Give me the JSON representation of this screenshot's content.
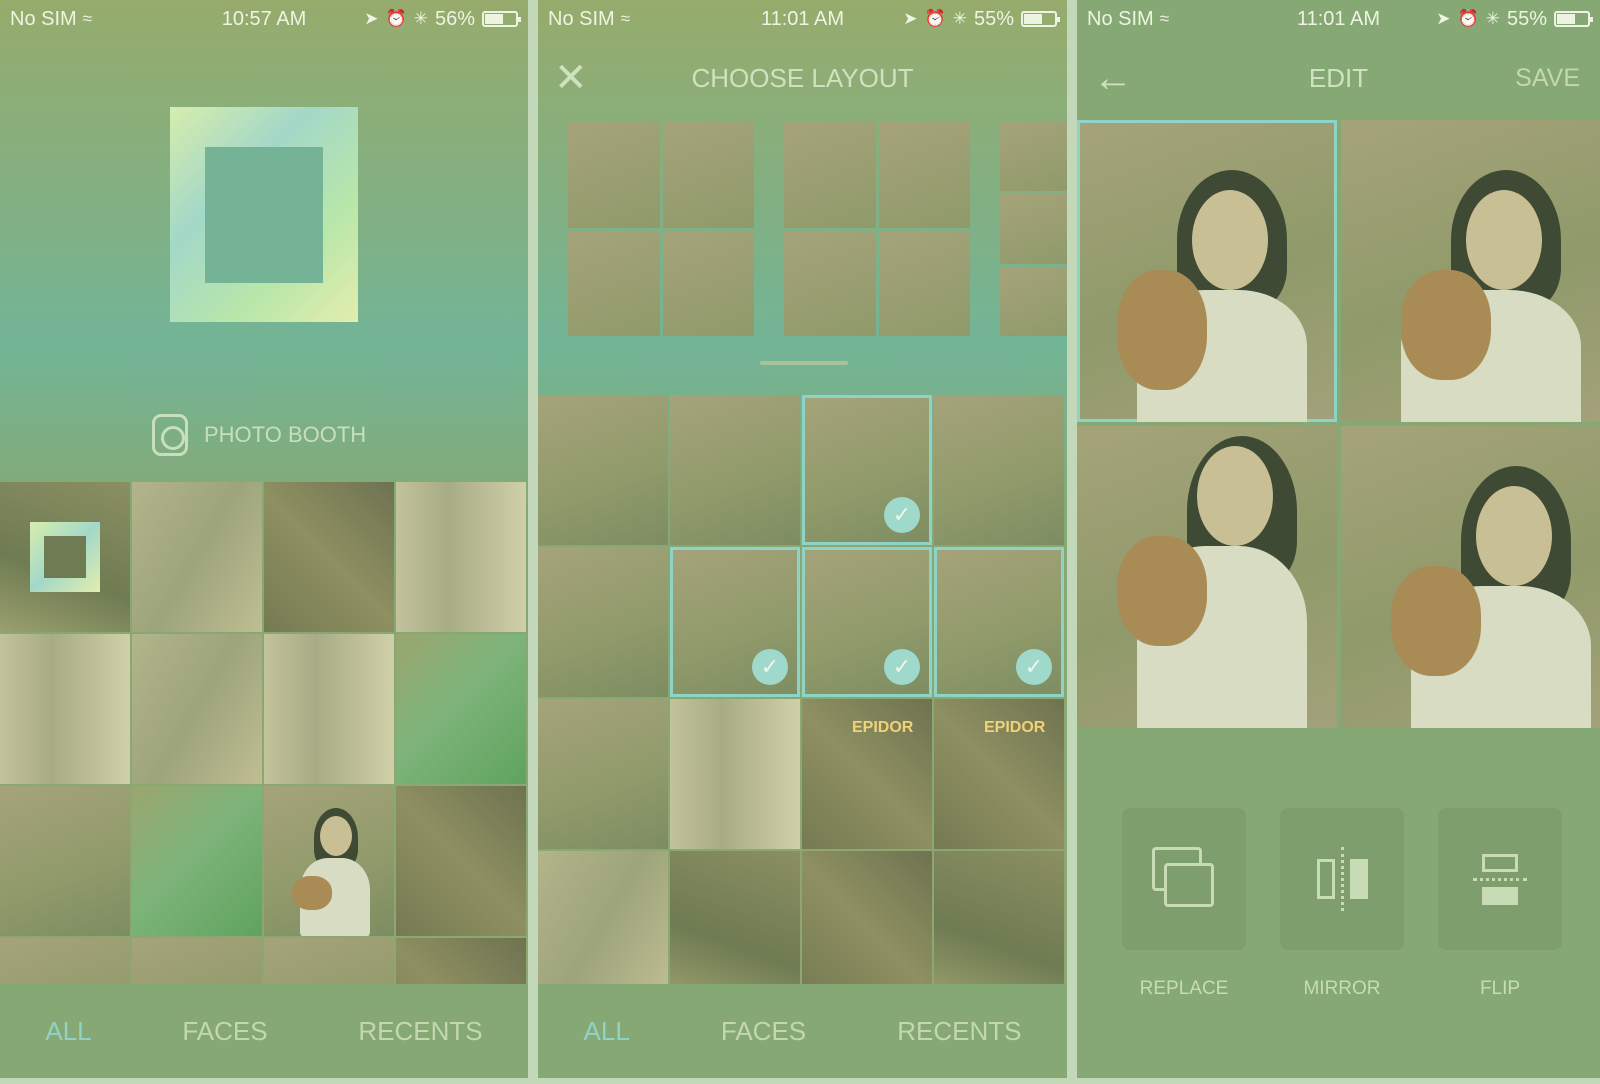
{
  "screens": [
    {
      "status": {
        "carrier": "No SIM",
        "time": "10:57 AM",
        "battery_pct": "56%",
        "battery_level": 0.56
      },
      "photo_booth_label": "PHOTO BOOTH",
      "tabs": [
        {
          "label": "ALL",
          "active": true
        },
        {
          "label": "FACES"
        },
        {
          "label": "RECENTS"
        }
      ]
    },
    {
      "status": {
        "carrier": "No SIM",
        "time": "11:01 AM",
        "battery_pct": "55%",
        "battery_level": 0.55
      },
      "title": "CHOOSE LAYOUT",
      "close_icon": "close-icon",
      "sign_text": "EPIDOR",
      "tabs": [
        {
          "label": "ALL",
          "active": true
        },
        {
          "label": "FACES"
        },
        {
          "label": "RECENTS"
        }
      ]
    },
    {
      "status": {
        "carrier": "No SIM",
        "time": "11:01 AM",
        "battery_pct": "55%",
        "battery_level": 0.55
      },
      "title": "EDIT",
      "save_label": "SAVE",
      "back_icon": "back-arrow-icon",
      "tools": [
        {
          "label": "REPLACE",
          "icon": "replace-icon"
        },
        {
          "label": "MIRROR",
          "icon": "mirror-icon"
        },
        {
          "label": "FLIP",
          "icon": "flip-icon"
        }
      ]
    }
  ],
  "colors": {
    "accent": "#8fd3c7",
    "tab_inactive": "#c3d7b0",
    "overlay": "#86a874"
  }
}
